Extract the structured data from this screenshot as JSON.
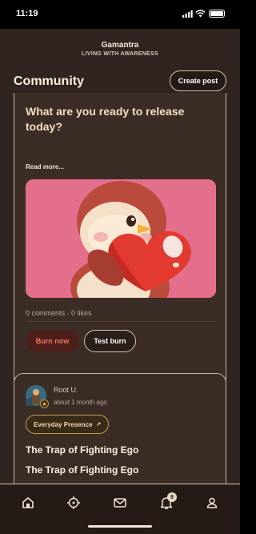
{
  "status_bar": {
    "time": "11:19"
  },
  "header": {
    "brand": "Gamantra",
    "tagline": "LIVING WITH AWARENESS",
    "page_title": "Community",
    "create_post_label": "Create post"
  },
  "posts": [
    {
      "question": "What are you ready to release today?",
      "read_more": "Read more...",
      "image": "heart-hugging-bird-illustration",
      "stats": "0 comments · 0 likes",
      "burn_label": "Burn now",
      "test_burn_label": "Test burn"
    },
    {
      "author": "Root U.",
      "time": "about 1 month ago",
      "tag": "Everyday Presence",
      "tag_icon": "arrow-up-right-icon",
      "title": "The Trap of Fighting Ego",
      "title_repeat": "The Trap of Fighting Ego"
    }
  ],
  "tabbar": {
    "items": [
      {
        "icon": "home-icon"
      },
      {
        "icon": "crosshair-icon"
      },
      {
        "icon": "mail-icon"
      },
      {
        "icon": "bell-icon",
        "badge": "9"
      },
      {
        "icon": "profile-icon"
      }
    ]
  },
  "colors": {
    "background": "#2f241f",
    "card": "#3b2d26",
    "accent_burn": "#f1785f",
    "illustration_bg": "#e46f8c"
  }
}
